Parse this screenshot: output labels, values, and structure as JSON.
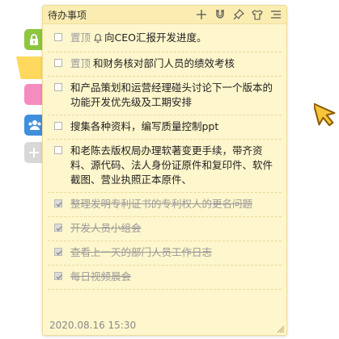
{
  "note": {
    "title": "待办事项",
    "pin_label": "置顶",
    "items": [
      {
        "pinned": true,
        "bell": true,
        "text": "向CEO汇报开发进度。",
        "done": false
      },
      {
        "pinned": true,
        "bell": false,
        "text": "和财务核对部门人员的绩效考核",
        "done": false
      },
      {
        "pinned": false,
        "bell": false,
        "text": "和产品策划和运营经理碰头讨论下一个版本的功能开发优先级及工期安排",
        "done": false
      },
      {
        "pinned": false,
        "bell": false,
        "text": "搜集各种资料，编写质量控制ppt",
        "done": false
      },
      {
        "pinned": false,
        "bell": false,
        "text": "和老陈去版权局办理软著变更手续，带齐资料、源代码、法人身份证原件和复印件、软件截图、营业执照正本原件、",
        "done": false
      },
      {
        "pinned": false,
        "bell": false,
        "text": "整理发明专利证书的专利权人的更名问题",
        "done": true
      },
      {
        "pinned": false,
        "bell": false,
        "text": "开发人员小组会",
        "done": true
      },
      {
        "pinned": false,
        "bell": false,
        "text": "查看上一天的部门人员工作日志",
        "done": true
      },
      {
        "pinned": false,
        "bell": false,
        "text": "每日视频晨会",
        "done": true
      }
    ],
    "timestamp": "2020.08.16  15:30"
  },
  "toolbar_icons": [
    "add-icon",
    "magnet-icon",
    "pin-icon",
    "skin-icon",
    "menu-icon"
  ],
  "tabs": [
    "lock-icon",
    "yellow",
    "pink",
    "users-icon",
    "add-icon"
  ],
  "colors": {
    "note_bg": "#fef6cc",
    "tab_green": "#8dc63f",
    "tab_yellow": "#ffd95e",
    "tab_pink": "#f58cc0",
    "tab_blue": "#3f8fdc",
    "tab_gray": "#d8d8d8"
  }
}
